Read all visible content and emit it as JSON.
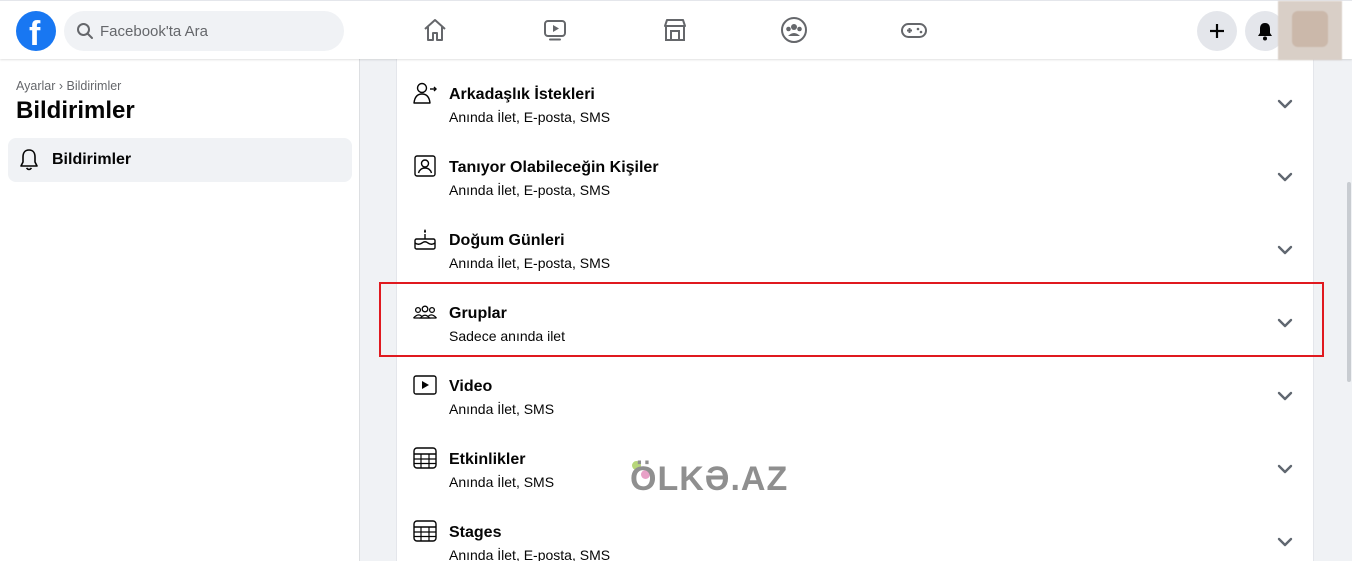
{
  "topbar": {
    "logo_letter": "f",
    "search": {
      "placeholder": "Facebook'ta Ara"
    },
    "nav_icons": [
      "home-icon",
      "video-icon",
      "marketplace-icon",
      "groups-icon",
      "gaming-icon"
    ],
    "create_icon": "plus-icon",
    "notifications_icon": "bell-icon"
  },
  "sidebar": {
    "breadcrumb": "Ayarlar › Bildirimler",
    "title": "Bildirimler",
    "items": [
      {
        "label": "Bildirimler",
        "icon": "bell-icon"
      }
    ]
  },
  "settings": [
    {
      "title": "Arkadaşlık İstekleri",
      "subtitle": "Anında İlet, E-posta, SMS",
      "icon": "friend-request-icon"
    },
    {
      "title": "Tanıyor Olabileceğin Kişiler",
      "subtitle": "Anında İlet, E-posta, SMS",
      "icon": "contact-card-icon"
    },
    {
      "title": "Doğum Günleri",
      "subtitle": "Anında İlet, E-posta, SMS",
      "icon": "birthday-cake-icon"
    },
    {
      "title": "Gruplar",
      "subtitle": "Sadece anında ilet",
      "icon": "groups-icon"
    },
    {
      "title": "Video",
      "subtitle": "Anında İlet, SMS",
      "icon": "video-icon"
    },
    {
      "title": "Etkinlikler",
      "subtitle": "Anında İlet, SMS",
      "icon": "calendar-icon"
    },
    {
      "title": "Stages",
      "subtitle": "Anında İlet, E-posta, SMS",
      "icon": "calendar-icon"
    }
  ],
  "watermark": "ÖLKƏ.AZ",
  "colors": {
    "brand": "#1877f2",
    "highlight": "#e0191f"
  }
}
